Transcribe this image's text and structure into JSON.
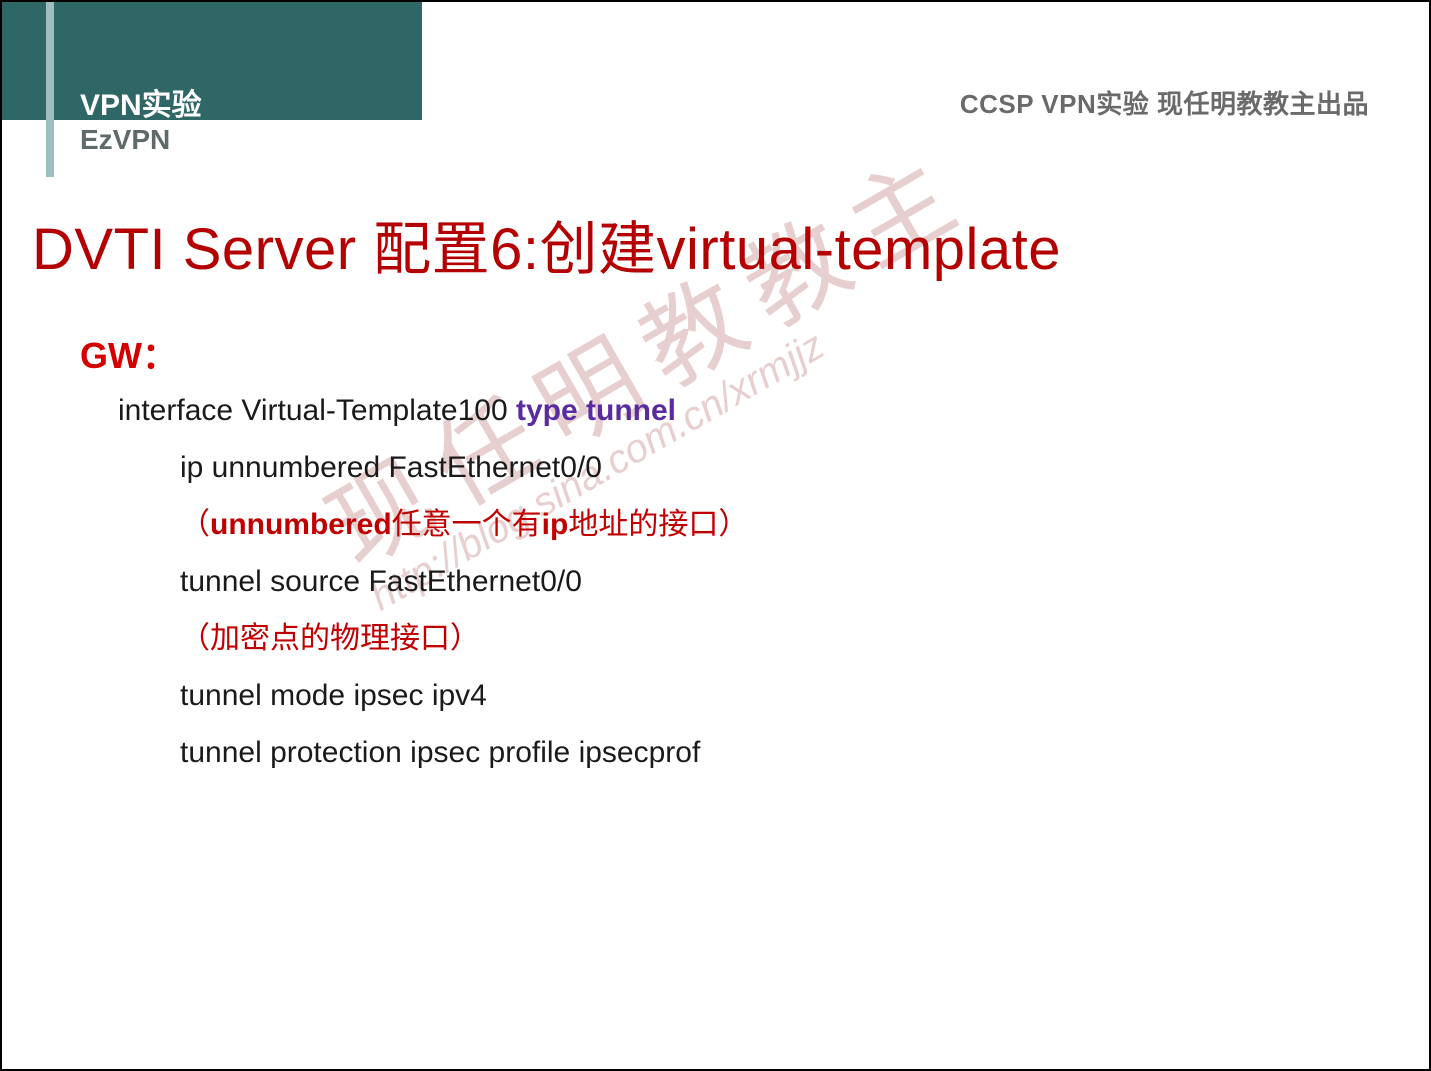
{
  "header": {
    "title": "VPN实验",
    "subtitle": "EzVPN",
    "credit": "CCSP VPN实验 现任明教教主出品"
  },
  "slide": {
    "title": "DVTI Server 配置6:创建virtual-template",
    "gw_label": "GW："
  },
  "config": {
    "line1_a": "interface Virtual-Template100 ",
    "line1_b": "type tunnel",
    "line2": "ip unnumbered FastEthernet0/0",
    "line3_a": "（",
    "line3_b": "unnumbered",
    "line3_c": "任意一个有",
    "line3_d": "ip",
    "line3_e": "地址的接口）",
    "line4": "tunnel source FastEthernet0/0",
    "line5": "（加密点的物理接口）",
    "line6": "tunnel mode ipsec ipv4",
    "line7": "tunnel protection ipsec profile ipsecprof"
  },
  "watermark": {
    "big": "现任明教教主",
    "url": "http://blog.sina.com.cn/xrmjjz"
  }
}
